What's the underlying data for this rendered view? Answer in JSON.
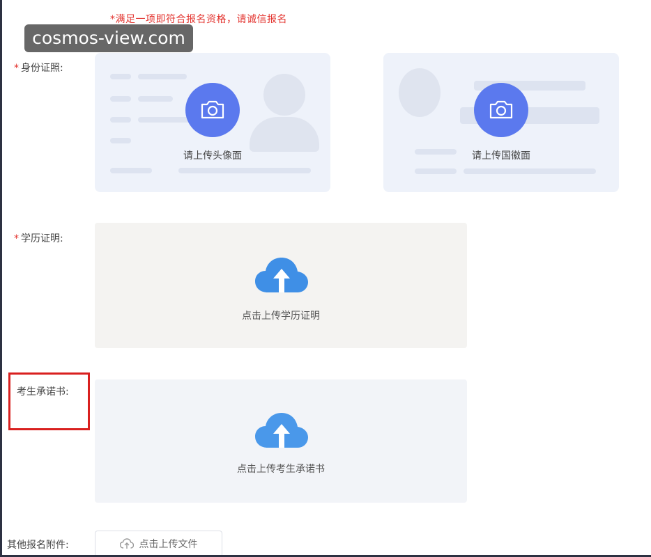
{
  "form": {
    "notice": "*满足一项即符合报名资格，请诚信报名",
    "watermark": "cosmos-view.com",
    "required_mark": "*",
    "id_label": "身份证照:",
    "id_front_caption": "请上传头像面",
    "id_back_caption": "请上传国徽面",
    "edu_label": "学历证明:",
    "edu_upload_caption": "点击上传学历证明",
    "pledge_label": "考生承诺书:",
    "pledge_upload_caption": "点击上传考生承诺书",
    "attachment_label": "其他报名附件:",
    "attachment_button": "点击上传文件"
  },
  "icons": {
    "camera": "camera-icon",
    "cloud_upload": "cloud-upload-icon"
  },
  "colors": {
    "required": "#e3342f",
    "camera_button": "#5b79ee",
    "cloud_icon": "#3f8fe6",
    "highlight": "#d9201f"
  }
}
